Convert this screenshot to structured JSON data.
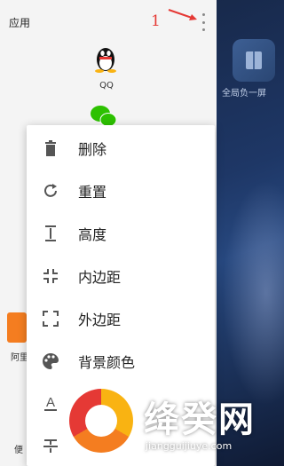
{
  "panel": {
    "title": "应用",
    "annotation": "1"
  },
  "apps": {
    "qq_label": "QQ"
  },
  "peek": {
    "label_1": "阿里",
    "label_2": "便"
  },
  "home": {
    "right_app_label": "全局负一屏"
  },
  "menu": {
    "items": [
      {
        "label": "删除",
        "icon": "trash-icon"
      },
      {
        "label": "重置",
        "icon": "refresh-icon"
      },
      {
        "label": "高度",
        "icon": "height-icon"
      },
      {
        "label": "内边距",
        "icon": "inner-padding-icon"
      },
      {
        "label": "外边距",
        "icon": "outer-padding-icon"
      },
      {
        "label": "背景颜色",
        "icon": "palette-icon"
      },
      {
        "label": "",
        "icon": "text-color-icon"
      },
      {
        "label": "",
        "icon": "strikethrough-icon"
      }
    ]
  },
  "watermark": {
    "text": "绛癸网",
    "url": "jiangguijiuye.com"
  },
  "colors": {
    "accent": "#e53935",
    "menu_bg": "#ffffff",
    "panel_bg": "#f4f4f4",
    "icon": "#555555"
  }
}
